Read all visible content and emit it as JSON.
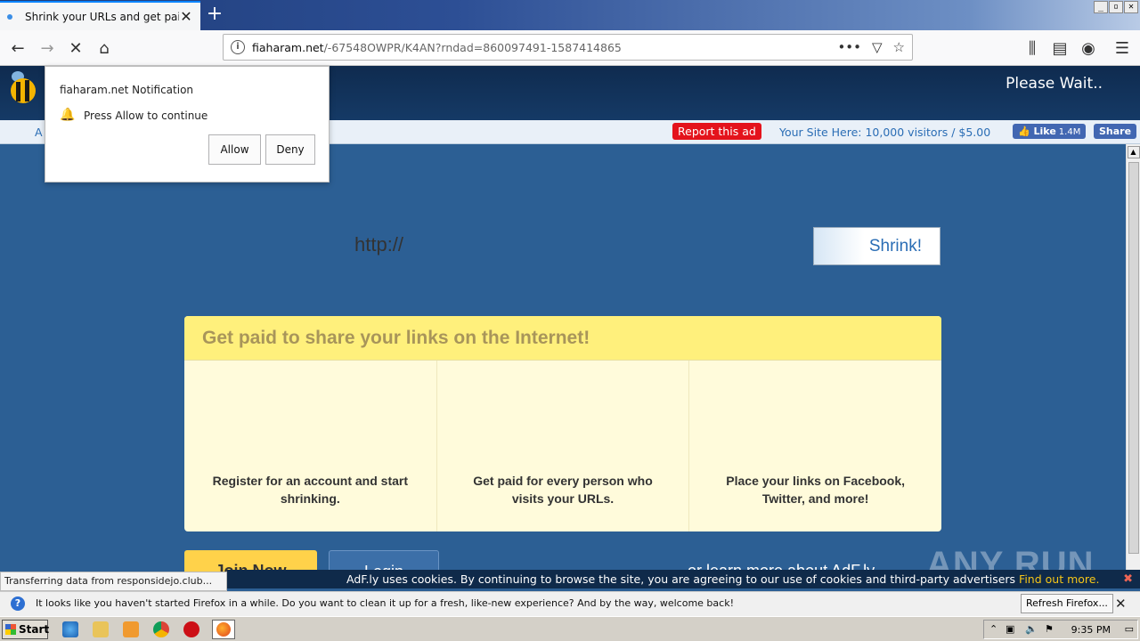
{
  "browser": {
    "tab_title": "Shrink your URLs and get paid!",
    "tab_close": "✕",
    "new_tab": "+",
    "window_controls": [
      "_",
      "▫",
      "✕"
    ],
    "url_domain": "fiaharam.net",
    "url_path": "/-67548OWPR/K4AN?rndad=860097491-1587414865",
    "icons": {
      "back": "←",
      "forward": "→",
      "stop": "✕",
      "home": "⌂",
      "more": "•••",
      "pocket": "▽",
      "star": "☆",
      "library": "⫼",
      "sidebar": "▤",
      "account": "◉",
      "menu": "☰"
    }
  },
  "notification_popup": {
    "title": "fiaharam.net Notification",
    "message": "Press Allow to continue",
    "allow": "Allow",
    "deny": "Deny"
  },
  "header": {
    "please_wait": "Please Wait.."
  },
  "adbar": {
    "left_text": "A",
    "report_ad": "Report this ad",
    "your_site": "Your Site Here: 10,000 visitors / $5.00",
    "fb_like": "Like",
    "fb_like_count": "1.4M",
    "fb_share": "Share"
  },
  "shrink": {
    "placeholder": "http://",
    "button": "Shrink!"
  },
  "panel": {
    "heading": "Get paid to share your links on the Internet!",
    "col1": "Register for an account and start shrinking.",
    "col2": "Get paid for every person who visits your URLs.",
    "col3": "Place your links on Facebook, Twitter, and more!"
  },
  "actions": {
    "join": "Join Now",
    "login": "Login",
    "learn_more": "or learn more about AdF.ly"
  },
  "cookie": {
    "text": "AdF.ly uses cookies. By continuing to browse the site, you are agreeing to our use of cookies and third-party advertisers",
    "link": "Find out more.",
    "close": "✖"
  },
  "status_text": "Transferring data from responsidejo.club...",
  "watermark": "ANY RUN",
  "firefox_bar": {
    "message": "It looks like you haven't started Firefox in a while. Do you want to clean it up for a fresh, like-new experience? And by the way, welcome back!",
    "refresh": "Refresh Firefox...",
    "close": "✕"
  },
  "taskbar": {
    "start": "Start",
    "time": "9:35 PM"
  }
}
